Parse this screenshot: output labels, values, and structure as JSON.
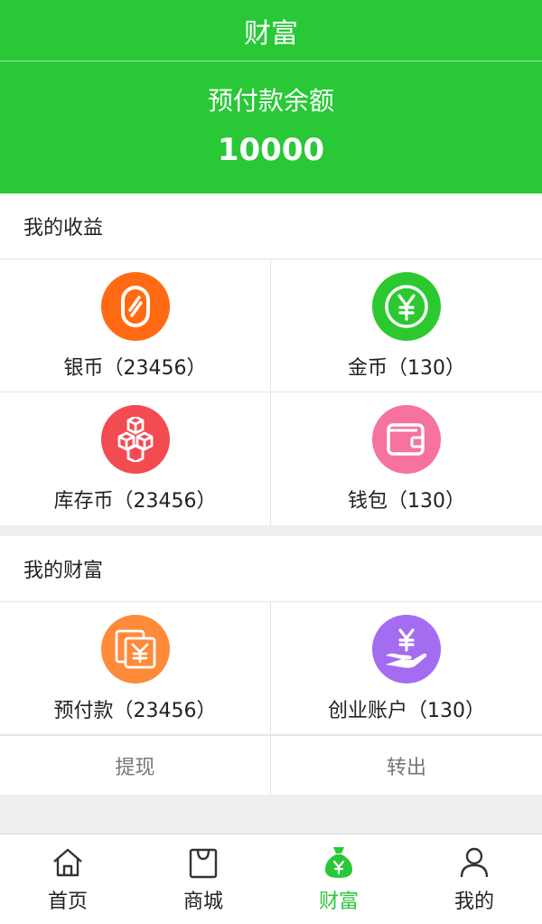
{
  "header": {
    "title": "财富"
  },
  "balance": {
    "label": "预付款余额",
    "amount": "10000"
  },
  "earnings": {
    "title": "我的收益",
    "items": [
      {
        "label": "银币（23456）",
        "icon": "silver-coin-icon",
        "color": "#ff6a13"
      },
      {
        "label": "金币（130）",
        "icon": "gold-coin-yen-icon",
        "color": "#2bc92f"
      },
      {
        "label": "库存币（23456）",
        "icon": "stock-boxes-icon",
        "color": "#f24b52"
      },
      {
        "label": "钱包（130）",
        "icon": "wallet-icon",
        "color": "#f6739d"
      }
    ]
  },
  "wealth": {
    "title": "我的财富",
    "items": [
      {
        "label": "预付款（23456）",
        "icon": "prepayment-icon",
        "color": "#ff8a3a"
      },
      {
        "label": "创业账户（130）",
        "icon": "hand-yen-icon",
        "color": "#a46cf0"
      }
    ],
    "actions": {
      "withdraw": "提现",
      "transfer": "转出"
    }
  },
  "tabbar": {
    "items": [
      {
        "label": "首页",
        "icon": "home-icon"
      },
      {
        "label": "商城",
        "icon": "shopping-bag-icon"
      },
      {
        "label": "财富",
        "icon": "money-bag-icon",
        "active": true
      },
      {
        "label": "我的",
        "icon": "user-icon"
      }
    ],
    "active_color": "#28c837"
  }
}
